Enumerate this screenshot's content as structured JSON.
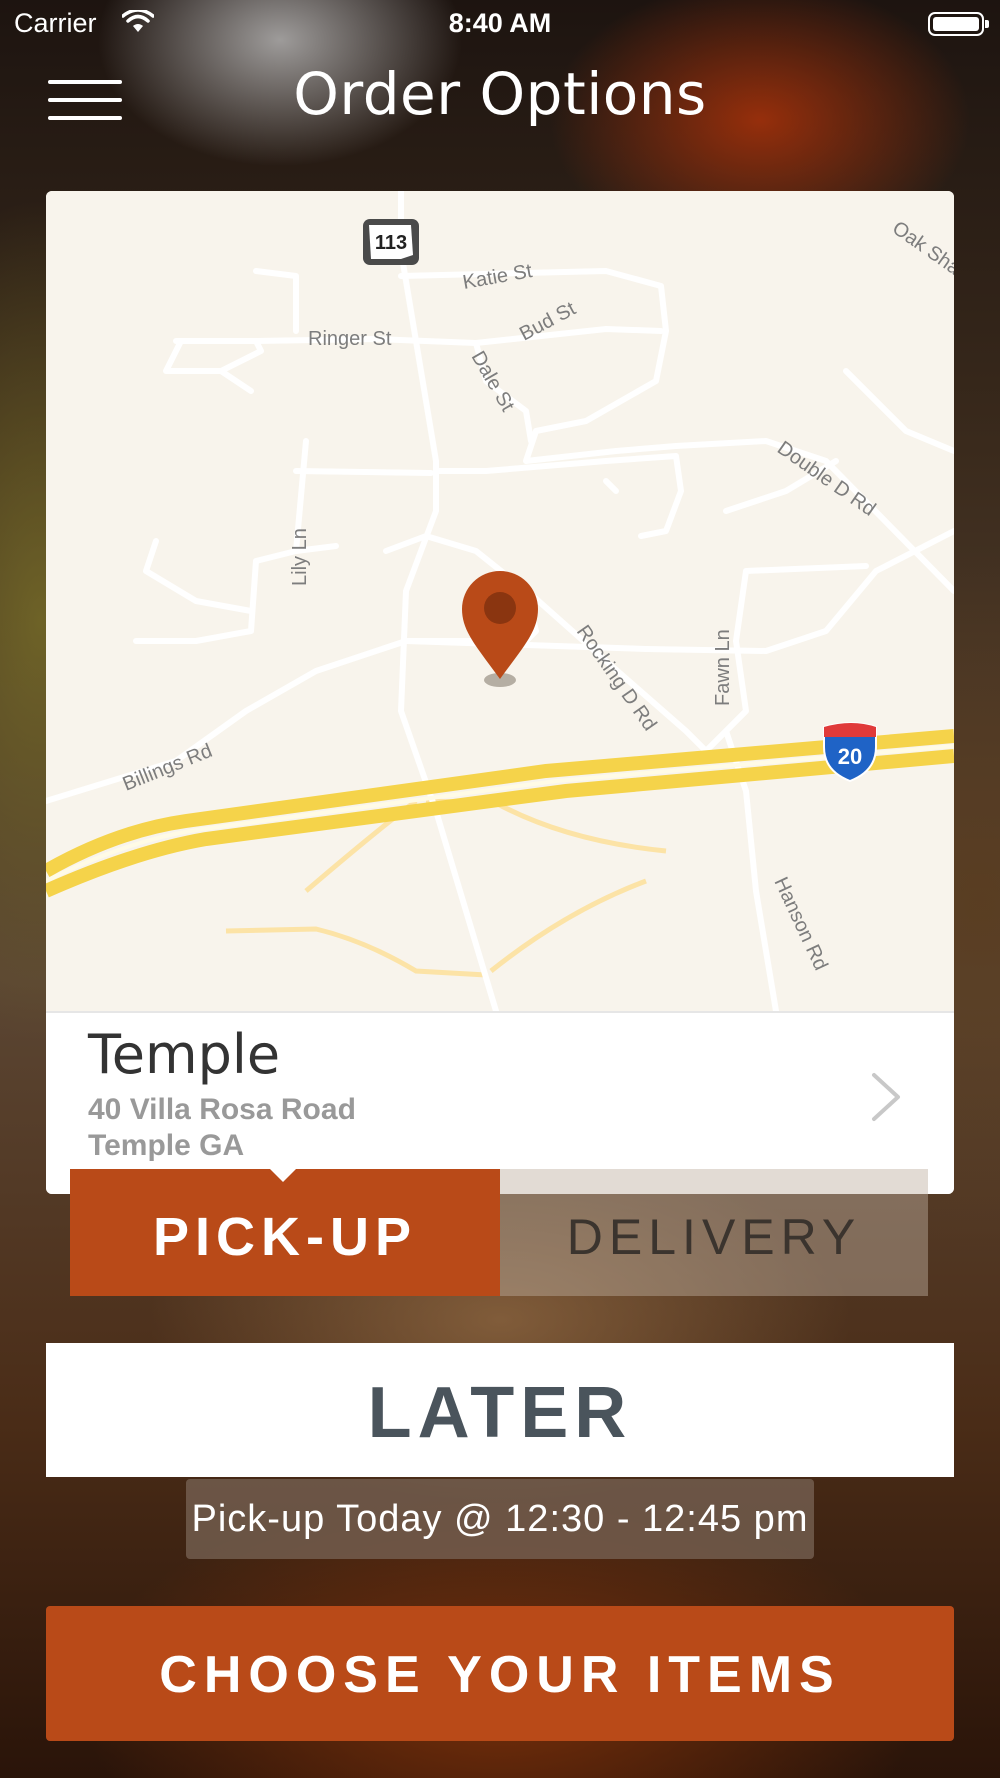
{
  "status_bar": {
    "carrier": "Carrier",
    "time": "8:40 AM"
  },
  "header": {
    "title": "Order Options"
  },
  "map": {
    "route_shield": "113",
    "interstate_shield": "20",
    "streets": [
      "Katie St",
      "Bud St",
      "Ringer St",
      "Dale St",
      "Double D Rd",
      "Oak Sha",
      "Lily Ln",
      "Rocking D Rd",
      "Fawn Ln",
      "Billings Rd",
      "Hanson Rd"
    ]
  },
  "location": {
    "name": "Temple",
    "address": "40 Villa Rosa Road",
    "city": "Temple GA"
  },
  "order_type": {
    "pickup_label": "PICK-UP",
    "delivery_label": "DELIVERY",
    "selected": "pickup"
  },
  "timing": {
    "later_label": "LATER",
    "pickup_info": "Pick-up Today @ 12:30 - 12:45 pm"
  },
  "actions": {
    "choose_label": "CHOOSE YOUR ITEMS"
  },
  "colors": {
    "accent": "#b94a18",
    "map_bg": "#f8f4ec",
    "highway": "#f5d34a"
  }
}
